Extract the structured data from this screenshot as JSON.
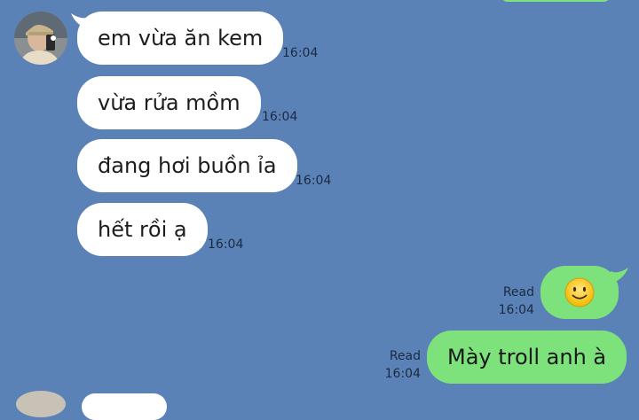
{
  "messages": [
    {
      "text": "em vừa ăn kem",
      "time": "16:04"
    },
    {
      "text": "vừa rửa mồm",
      "time": "16:04"
    },
    {
      "text": "đang hơi buồn ỉa",
      "time": "16:04"
    },
    {
      "text": "hết rồi ạ",
      "time": "16:04"
    }
  ],
  "sent": [
    {
      "emoji_icon": "smiling-face-emoji",
      "status": "Read",
      "time": "16:04"
    },
    {
      "text": "Mày troll anh à",
      "status": "Read",
      "time": "16:04"
    }
  ],
  "colors": {
    "background": "#5b82b7",
    "incoming_bubble": "#ffffff",
    "outgoing_bubble": "#7de27c"
  }
}
